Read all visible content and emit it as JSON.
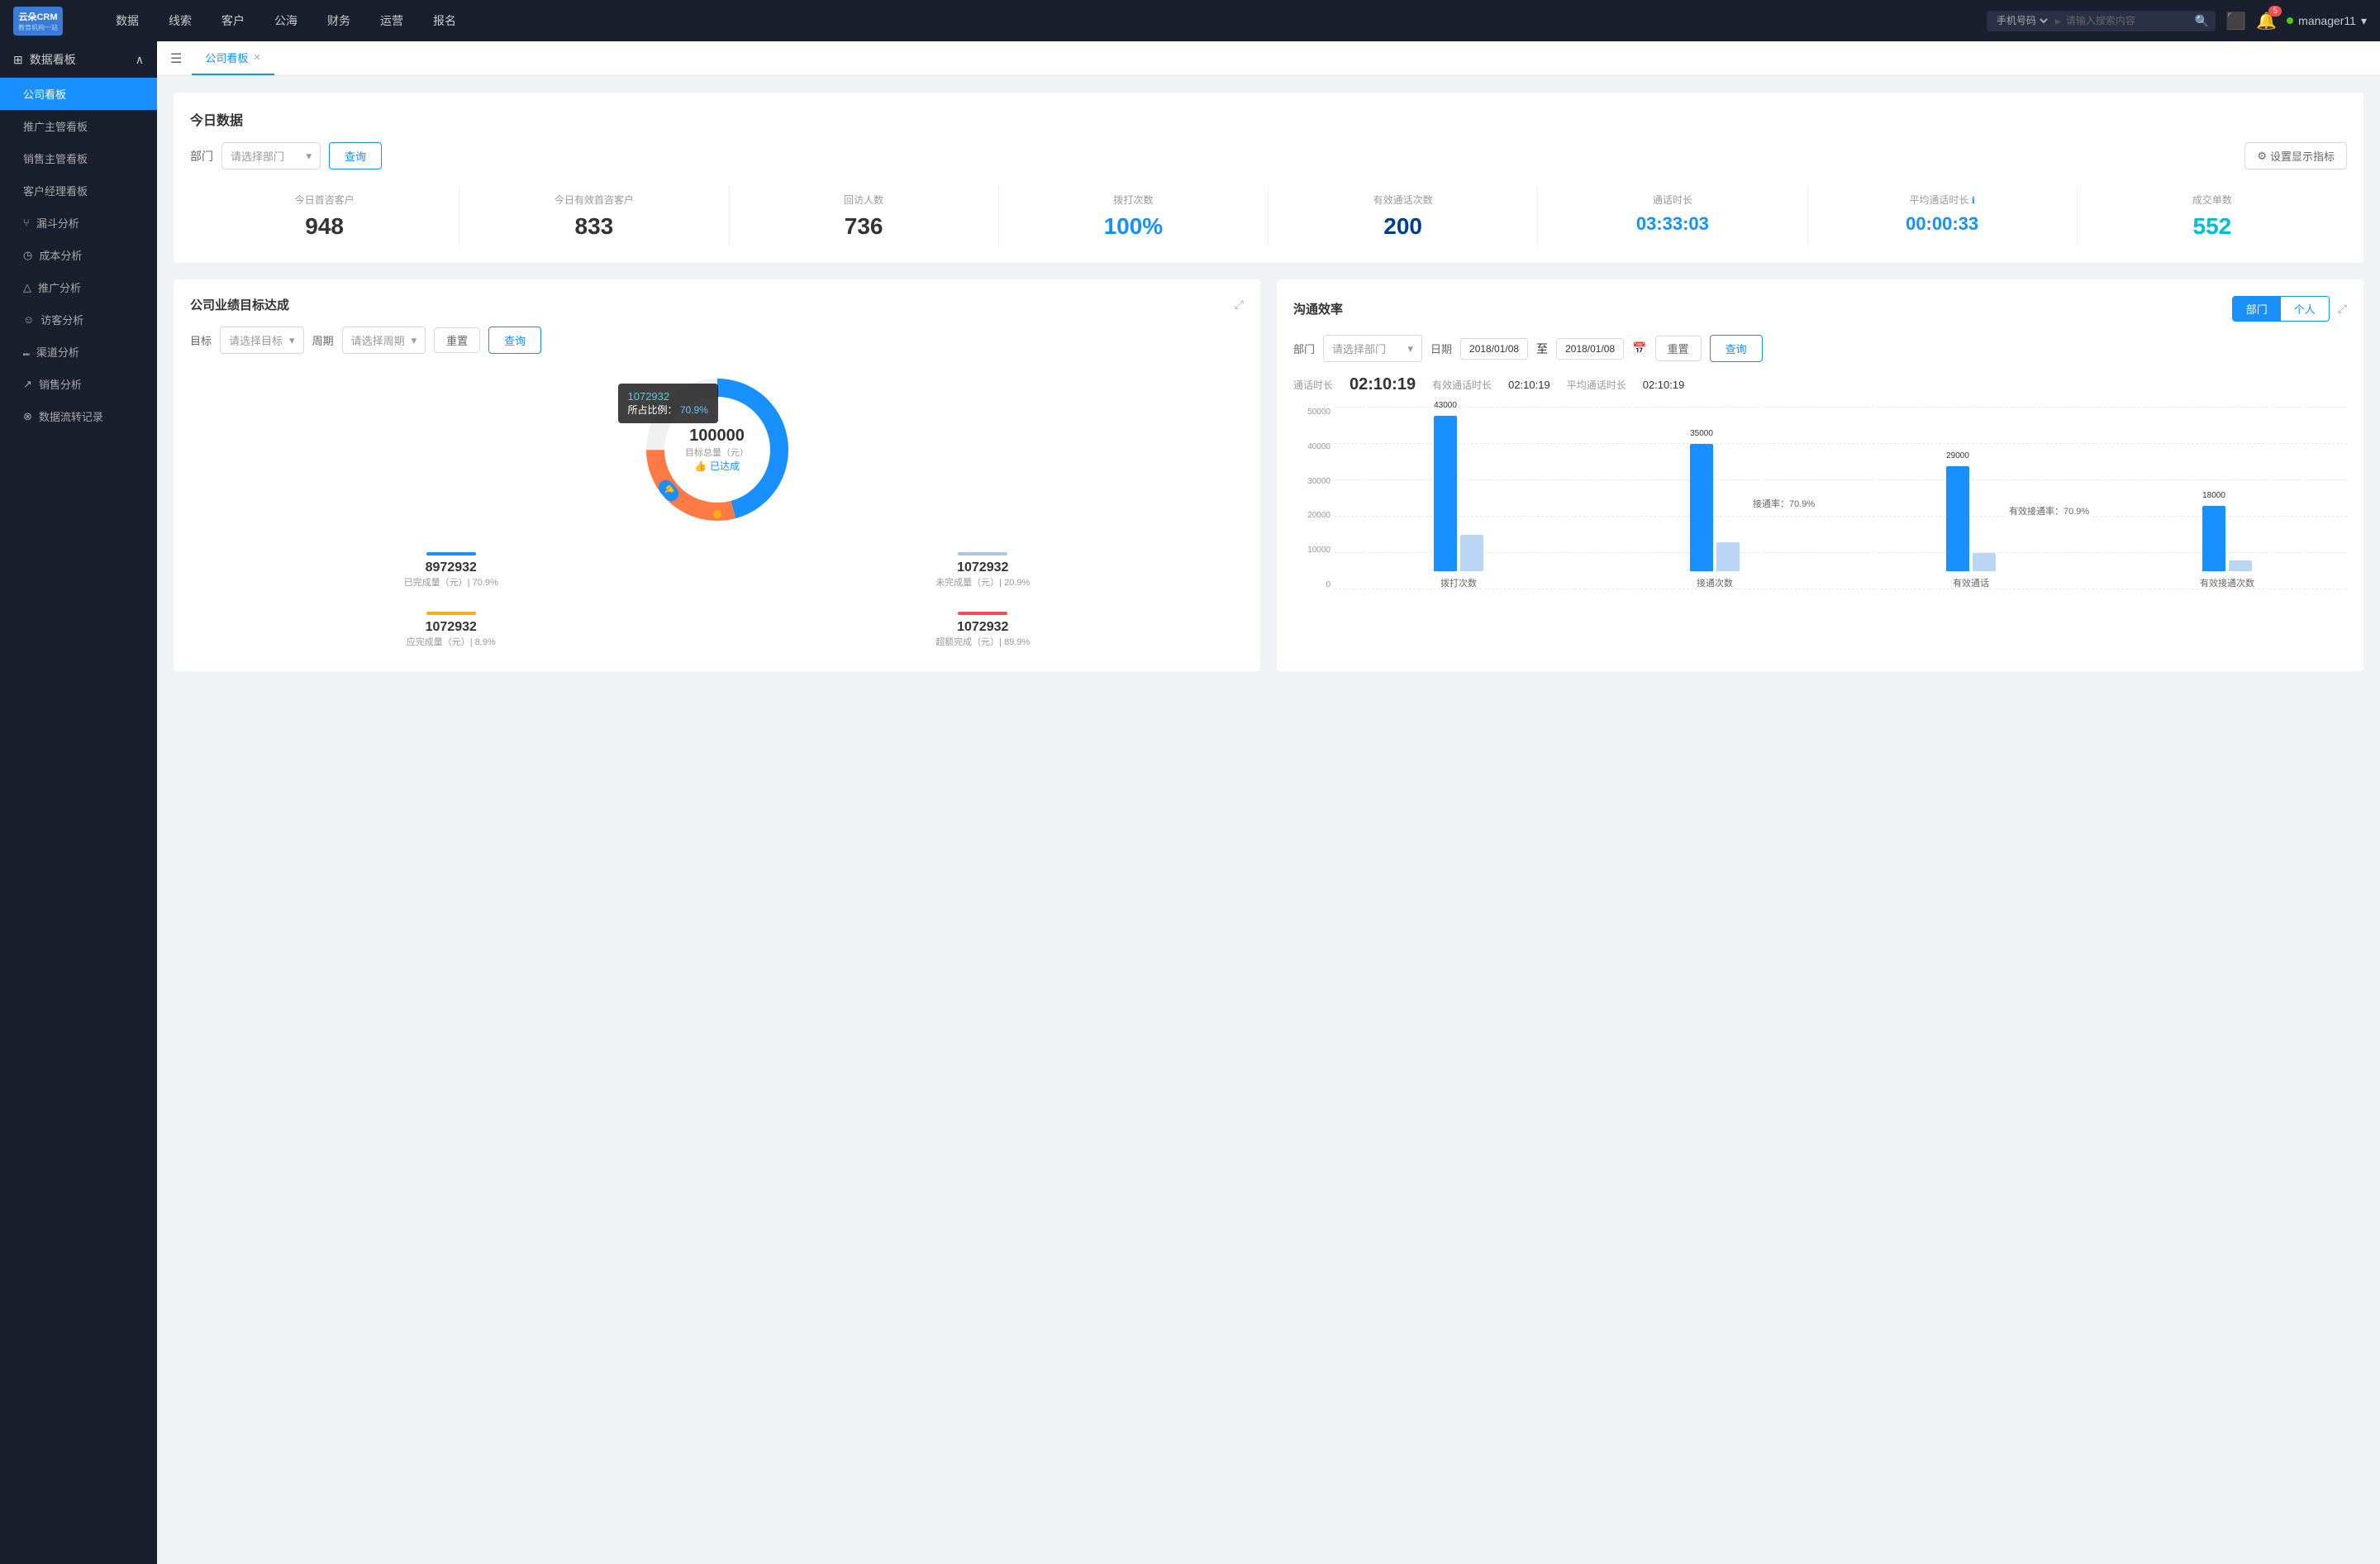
{
  "app": {
    "logo_title": "云朵CRM",
    "logo_sub": "教育机构一站 | 招生服务云平台"
  },
  "nav": {
    "items": [
      "数据",
      "线索",
      "客户",
      "公海",
      "财务",
      "运营",
      "报名"
    ]
  },
  "search": {
    "placeholder": "请输入搜索内容",
    "options": [
      "手机号码"
    ]
  },
  "user": {
    "name": "manager11",
    "notification_count": "5"
  },
  "sidebar": {
    "section": "数据看板",
    "items": [
      {
        "label": "公司看板",
        "active": true
      },
      {
        "label": "推广主管看板",
        "active": false
      },
      {
        "label": "销售主管看板",
        "active": false
      },
      {
        "label": "客户经理看板",
        "active": false
      },
      {
        "label": "漏斗分析",
        "active": false
      },
      {
        "label": "成本分析",
        "active": false
      },
      {
        "label": "推广分析",
        "active": false
      },
      {
        "label": "访客分析",
        "active": false
      },
      {
        "label": "渠道分析",
        "active": false
      },
      {
        "label": "销售分析",
        "active": false
      },
      {
        "label": "数据流转记录",
        "active": false
      }
    ]
  },
  "tab": {
    "label": "公司看板"
  },
  "today_data": {
    "title": "今日数据",
    "filter_label": "部门",
    "filter_placeholder": "请选择部门",
    "query_btn": "查询",
    "settings_btn": "设置显示指标",
    "stats": [
      {
        "label": "今日首咨客户",
        "value": "948",
        "color": "black"
      },
      {
        "label": "今日有效首咨客户",
        "value": "833",
        "color": "black"
      },
      {
        "label": "回访人数",
        "value": "736",
        "color": "black"
      },
      {
        "label": "拨打次数",
        "value": "100%",
        "color": "blue"
      },
      {
        "label": "有效通话次数",
        "value": "200",
        "color": "dark-blue"
      },
      {
        "label": "通话时长",
        "value": "03:33:03",
        "color": "blue"
      },
      {
        "label": "平均通话时长",
        "value": "00:00:33",
        "color": "blue"
      },
      {
        "label": "成交单数",
        "value": "552",
        "color": "cyan"
      }
    ]
  },
  "goal_panel": {
    "title": "公司业绩目标达成",
    "goal_label": "目标",
    "goal_placeholder": "请选择目标",
    "period_label": "周期",
    "period_placeholder": "请选择周期",
    "reset_btn": "重置",
    "query_btn": "查询",
    "tooltip": {
      "value": "1072932",
      "pct_label": "所占比例：",
      "pct_value": "70.9%"
    },
    "donut": {
      "center_value": "100000",
      "center_label": "目标总量（元）",
      "center_sub": "已达成"
    },
    "stats": [
      {
        "label": "已完成量（元）| 70.9%",
        "value": "8972932",
        "bar_color": "#1890ff"
      },
      {
        "label": "未完成量（元）| 20.9%",
        "value": "1072932",
        "bar_color": "#b0c4de"
      },
      {
        "label": "应完成量（元）| 8.9%",
        "value": "1072932",
        "bar_color": "#faad14"
      },
      {
        "label": "超额完成（元）| 89.9%",
        "value": "1072932",
        "bar_color": "#ff4d4f"
      }
    ]
  },
  "efficiency_panel": {
    "title": "沟通效率",
    "tab_dept": "部门",
    "tab_person": "个人",
    "dept_label": "部门",
    "dept_placeholder": "请选择部门",
    "date_label": "日期",
    "date_from": "2018/01/08",
    "date_to": "2018/01/08",
    "reset_btn": "重置",
    "query_btn": "查询",
    "time_row": {
      "call_label": "通话时长",
      "call_value": "02:10:19",
      "eff_label": "有效通话时长",
      "eff_value": "02:10:19",
      "avg_label": "平均通话时长",
      "avg_value": "02:10:19"
    },
    "chart": {
      "y_labels": [
        "0",
        "10000",
        "20000",
        "30000",
        "40000",
        "50000"
      ],
      "groups": [
        {
          "label": "拨打次数",
          "bar1": {
            "value": 43000,
            "label": "43000"
          },
          "bar2": {
            "value": 10000,
            "label": ""
          }
        },
        {
          "label": "接通次数",
          "bar1": {
            "value": 35000,
            "label": "35000"
          },
          "bar2": {
            "value": 8000,
            "label": ""
          },
          "annotation": "接通率：70.9%"
        },
        {
          "label": "有效通话",
          "bar1": {
            "value": 29000,
            "label": "29000"
          },
          "bar2": {
            "value": 5000,
            "label": ""
          },
          "annotation": "有效接通率：70.9%"
        },
        {
          "label": "有效接通次数",
          "bar1": {
            "value": 18000,
            "label": "18000"
          },
          "bar2": {
            "value": 3000,
            "label": ""
          }
        }
      ]
    }
  }
}
